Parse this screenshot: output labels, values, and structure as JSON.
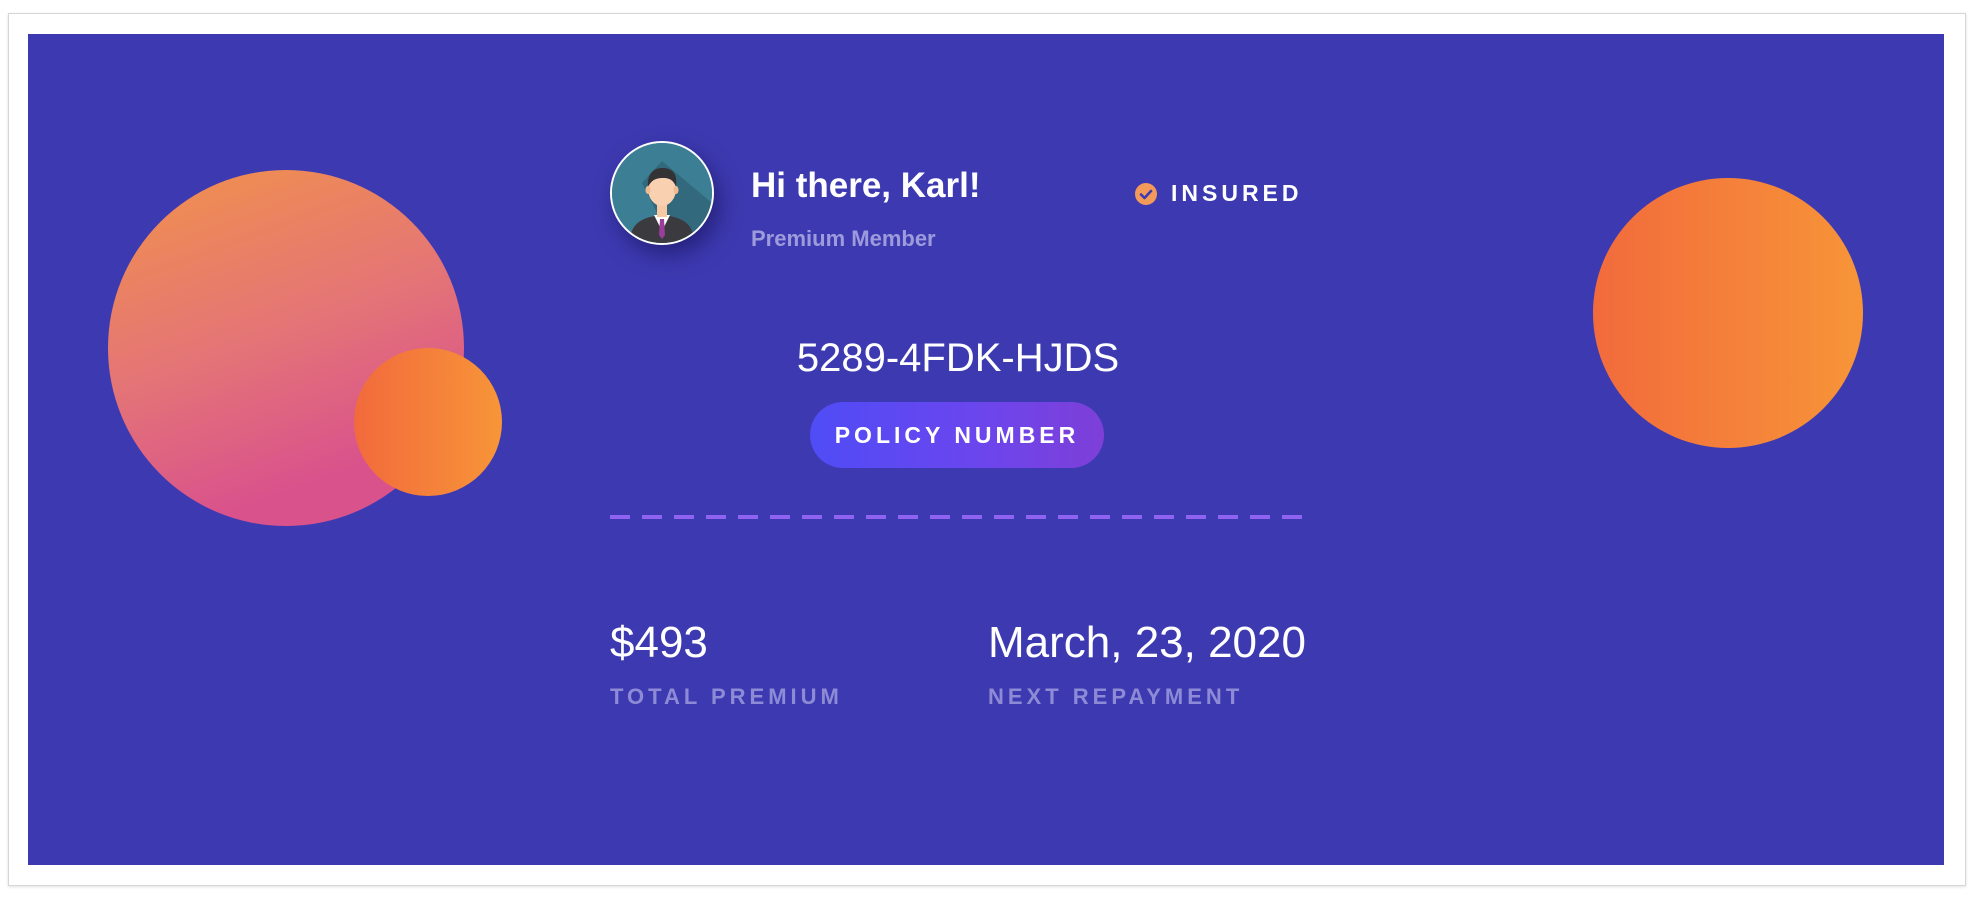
{
  "user": {
    "greeting": "Hi there, Karl!",
    "membership": "Premium Member",
    "avatar_icon": "businessman-avatar-icon"
  },
  "status": {
    "label": "INSURED",
    "icon": "check-circle-icon",
    "icon_color": "#f39a5a"
  },
  "policy": {
    "number": "5289-4FDK-HJDS",
    "label": "POLICY NUMBER"
  },
  "stats": {
    "premium": {
      "value": "$493",
      "label": "TOTAL PREMIUM"
    },
    "repayment": {
      "value": "March, 23, 2020",
      "label": "NEXT REPAYMENT"
    }
  },
  "colors": {
    "card_background": "#3d3ab1",
    "accent_orange": "#f26a3c",
    "accent_pink": "#d9528c",
    "pill_gradient_start": "#4f4cf6",
    "pill_gradient_end": "#7e3fd8",
    "divider": "#8f62f2",
    "muted_text": "#9d9bdc"
  }
}
